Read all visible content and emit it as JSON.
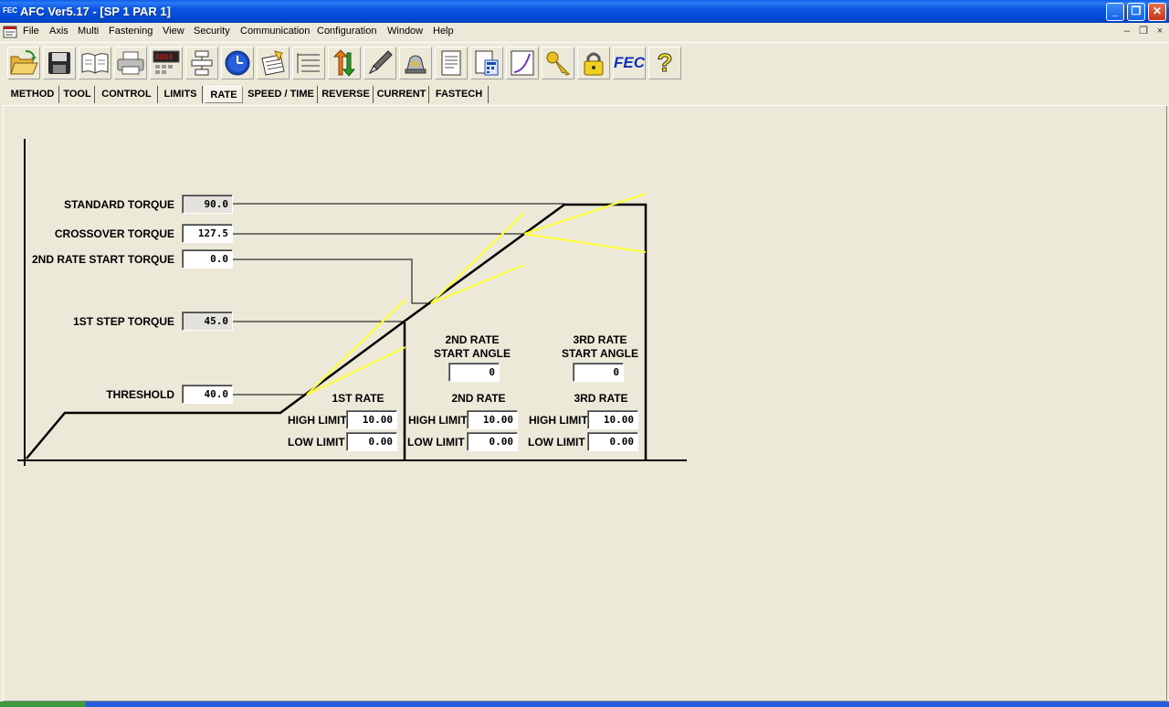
{
  "window": {
    "title": "AFC Ver5.17 - [SP 1 PAR 1]",
    "app_icon": "FEC",
    "minimize": "_",
    "restore": "❐",
    "close": "✕"
  },
  "menu": [
    "File",
    "Axis",
    "Multi",
    "Fastening",
    "View",
    "Security",
    "Communication",
    "Configuration",
    "Window",
    "Help"
  ],
  "mdi": {
    "minimize": "–",
    "restore": "❐",
    "close": "×"
  },
  "toolbar": {
    "icons": [
      "open-folder-icon",
      "save-disk-icon",
      "open-book-icon",
      "printer-icon",
      "monitor-display-icon",
      "flowchart-icon",
      "clock-icon",
      "edit-document-icon",
      "list-settings-icon",
      "up-down-arrows-icon",
      "pen-icon",
      "bell-icon",
      "document-icon",
      "calculator-icon",
      "graph-icon",
      "key-icon",
      "padlock-icon",
      "fec-logo-icon",
      "help-question-icon"
    ],
    "fec_label": "FEC",
    "help_label": "?"
  },
  "tabs": [
    {
      "label": "METHOD",
      "active": false
    },
    {
      "label": "TOOL",
      "active": false
    },
    {
      "label": "CONTROL",
      "active": false
    },
    {
      "label": "LIMITS",
      "active": false
    },
    {
      "label": "RATE",
      "active": true
    },
    {
      "label": "SPEED / TIME",
      "active": false
    },
    {
      "label": "REVERSE",
      "active": false
    },
    {
      "label": "CURRENT",
      "active": false
    },
    {
      "label": "FASTECH",
      "active": false
    }
  ],
  "rate": {
    "standard_torque": {
      "label": "STANDARD TORQUE",
      "value": "90.0"
    },
    "crossover_torque": {
      "label": "CROSSOVER TORQUE",
      "value": "127.5"
    },
    "second_rate_start_torque": {
      "label": "2ND RATE START TORQUE",
      "value": "0.0"
    },
    "first_step_torque": {
      "label": "1ST STEP TORQUE",
      "value": "45.0"
    },
    "threshold": {
      "label": "THRESHOLD",
      "value": "40.0"
    },
    "second_rate_start_angle": {
      "label_line1": "2ND RATE",
      "label_line2": "START ANGLE",
      "value": "0"
    },
    "third_rate_start_angle": {
      "label_line1": "3RD RATE",
      "label_line2": "START ANGLE",
      "value": "0"
    },
    "first_rate": {
      "title": "1ST RATE",
      "high_label": "HIGH LIMIT",
      "high": "10.00",
      "low_label": "LOW LIMIT",
      "low": "0.00"
    },
    "second_rate": {
      "title": "2ND RATE",
      "high_label": "HIGH LIMIT",
      "high": "10.00",
      "low_label": "LOW LIMIT",
      "low": "0.00"
    },
    "third_rate": {
      "title": "3RD RATE",
      "high_label": "HIGH LIMIT",
      "high": "10.00",
      "low_label": "LOW LIMIT",
      "low": "0.00"
    }
  },
  "colors": {
    "titlebar": "#0A5FE8",
    "face": "#ECE9D8",
    "rate_line": "#FFFF33",
    "curve": "#000000"
  }
}
